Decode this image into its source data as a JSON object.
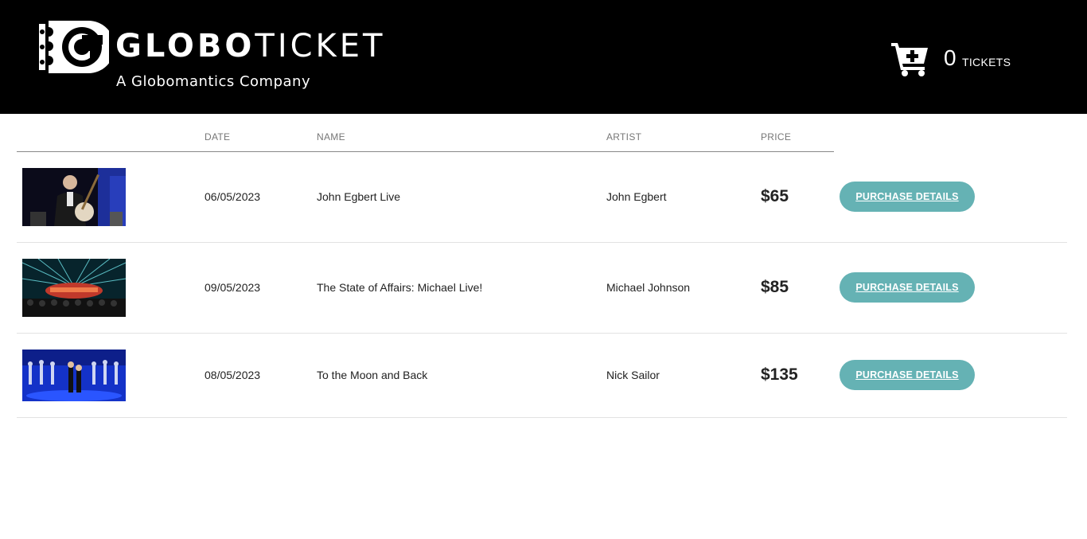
{
  "header": {
    "brand_bold": "GLOBO",
    "brand_thin": "TICKET",
    "tagline": "A Globomantics Company",
    "logo_icon": "ticket-g-logo-icon",
    "cart": {
      "icon": "cart-plus-icon",
      "count": "0",
      "label": "TICKETS"
    }
  },
  "table": {
    "headers": {
      "date": "DATE",
      "name": "NAME",
      "artist": "ARTIST",
      "price": "PRICE"
    },
    "rows": [
      {
        "image": "concert-banjo-player-photo",
        "date": "06/05/2023",
        "name": "John Egbert Live",
        "artist": "John Egbert",
        "price": "$65",
        "action": "PURCHASE DETAILS"
      },
      {
        "image": "concert-stage-lights-photo",
        "date": "09/05/2023",
        "name": "The State of Affairs: Michael Live!",
        "artist": "Michael Johnson",
        "price": "$85",
        "action": "PURCHASE DETAILS"
      },
      {
        "image": "dancers-on-stage-photo",
        "date": "08/05/2023",
        "name": "To the Moon and Back",
        "artist": "Nick Sailor",
        "price": "$135",
        "action": "PURCHASE DETAILS"
      }
    ]
  },
  "colors": {
    "header_bg": "#000000",
    "button": "#65b2b4",
    "text": "#222222"
  }
}
